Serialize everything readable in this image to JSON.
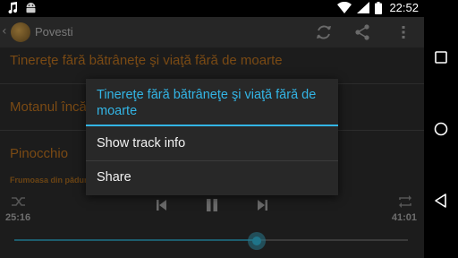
{
  "status_bar": {
    "time": "22:52",
    "icons": [
      "music-note-icon",
      "android-icon",
      "wifi-icon",
      "signal-icon",
      "battery-icon"
    ]
  },
  "action_bar": {
    "title": "Povesti",
    "icons": [
      "back-icon",
      "app-logo",
      "refresh-icon",
      "share-icon",
      "overflow-menu-icon"
    ]
  },
  "list": {
    "items": [
      {
        "title": "Tinereţe fără bătrâneţe şi viaţă fără de moarte"
      },
      {
        "title": "Motanul încă"
      },
      {
        "title": "Pinocchio"
      }
    ],
    "subtitle": "Frumoasa din pădur"
  },
  "player": {
    "elapsed": "25:16",
    "total": "41:01",
    "progress_fraction": 0.615,
    "icons": [
      "shuffle-icon",
      "previous-icon",
      "pause-icon",
      "next-icon",
      "repeat-icon"
    ]
  },
  "dialog": {
    "title": "Tinereţe fără bătrâneţe şi viaţă fără de moarte",
    "items": [
      {
        "label": "Show track info"
      },
      {
        "label": "Share"
      }
    ]
  },
  "navigation_bar": {
    "icons": [
      "recents-icon",
      "home-icon",
      "back-triangle-icon"
    ]
  },
  "colors": {
    "accent": "#33b5e5",
    "list_text": "#7a4a14",
    "dialog_bg": "#282828"
  }
}
